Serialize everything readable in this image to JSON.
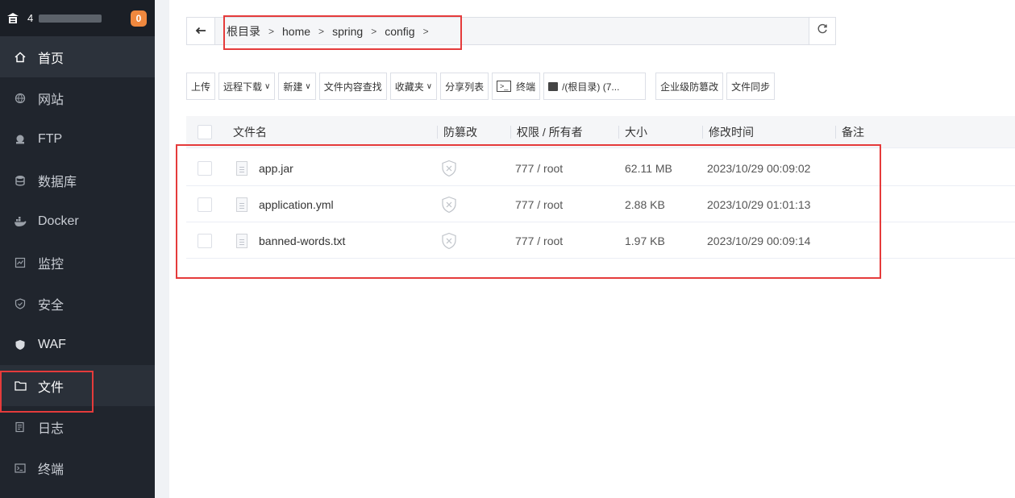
{
  "sidebar": {
    "server_ip": "4",
    "badge": "0",
    "items": [
      {
        "label": "首页",
        "icon": "home-icon"
      },
      {
        "label": "网站",
        "icon": "globe-icon"
      },
      {
        "label": "FTP",
        "icon": "ftp-icon"
      },
      {
        "label": "数据库",
        "icon": "database-icon"
      },
      {
        "label": "Docker",
        "icon": "docker-icon"
      },
      {
        "label": "监控",
        "icon": "monitor-icon"
      },
      {
        "label": "安全",
        "icon": "shield-icon"
      },
      {
        "label": "WAF",
        "icon": "waf-icon"
      },
      {
        "label": "文件",
        "icon": "folder-icon"
      },
      {
        "label": "日志",
        "icon": "log-icon"
      },
      {
        "label": "终端",
        "icon": "terminal-icon"
      }
    ],
    "active_item": "文件"
  },
  "pathbar": {
    "crumbs": [
      "根目录",
      "home",
      "spring",
      "config"
    ]
  },
  "toolbar": {
    "upload": "上传",
    "remote_download": "远程下载",
    "new": "新建",
    "search_content": "文件内容查找",
    "favorites": "收藏夹",
    "share_list": "分享列表",
    "terminal": "终端",
    "disk": "/(根目录) (7...",
    "tamper": "企业级防篡改",
    "sync": "文件同步"
  },
  "table": {
    "headers": {
      "name": "文件名",
      "tamper": "防篡改",
      "perm": "权限 / 所有者",
      "size": "大小",
      "mtime": "修改时间",
      "note": "备注"
    },
    "rows": [
      {
        "name": "app.jar",
        "perm": "777 / root",
        "size": "62.11 MB",
        "mtime": "2023/10/29 00:09:02"
      },
      {
        "name": "application.yml",
        "perm": "777 / root",
        "size": "2.88 KB",
        "mtime": "2023/10/29 01:01:13"
      },
      {
        "name": "banned-words.txt",
        "perm": "777 / root",
        "size": "1.97 KB",
        "mtime": "2023/10/29 00:09:14"
      }
    ]
  },
  "colors": {
    "sidebar_bg": "#20252d",
    "highlight_red": "#e53b3b",
    "badge_orange": "#f0883e"
  }
}
